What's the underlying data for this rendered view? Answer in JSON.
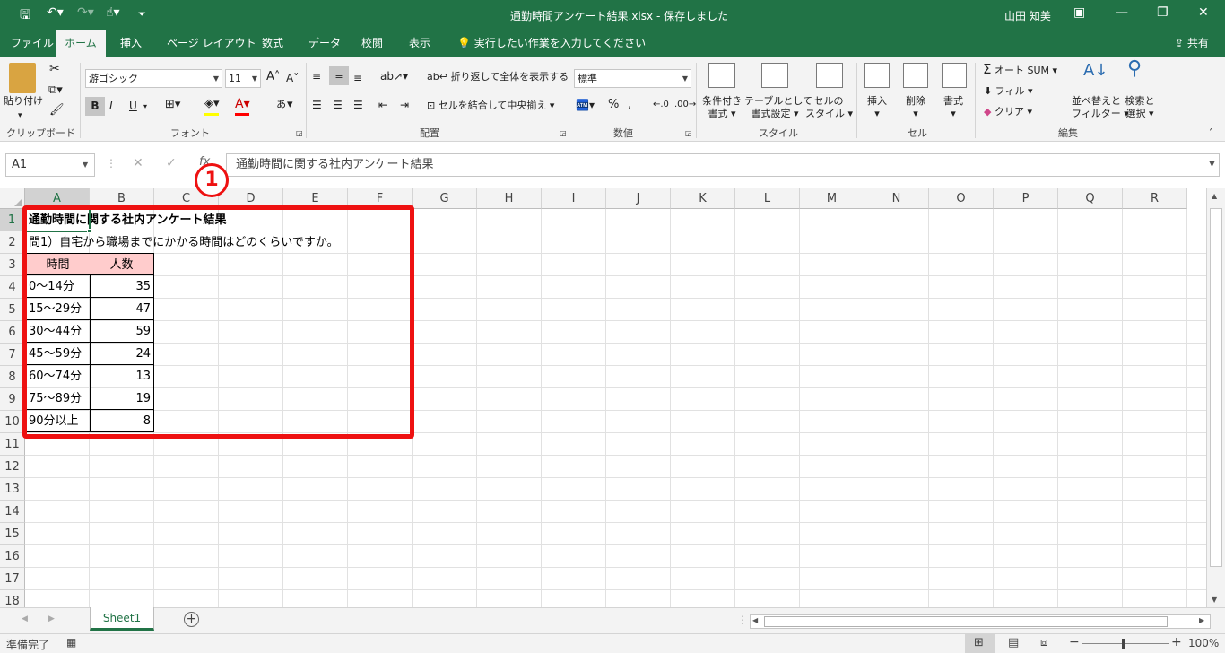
{
  "window": {
    "title": "通勤時間アンケート結果.xlsx  -  保存しました",
    "user": "山田 知美"
  },
  "ribbon_tabs": [
    "ファイル",
    "ホーム",
    "挿入",
    "ページ レイアウト",
    "数式",
    "データ",
    "校閲",
    "表示"
  ],
  "active_tab": "ホーム",
  "tell_me": "実行したい作業を入力してください",
  "share": "共有",
  "clipboard": {
    "paste": "貼り付け",
    "label": "クリップボード"
  },
  "font": {
    "name": "游ゴシック",
    "size": "11",
    "bold": "B",
    "italic": "I",
    "underline": "U",
    "label": "フォント"
  },
  "alignment": {
    "wrap": "折り返して全体を表示する",
    "merge": "セルを結合して中央揃え",
    "label": "配置"
  },
  "number": {
    "format": "標準",
    "label": "数値"
  },
  "styles": {
    "conditional": "条件付き",
    "conditional2": "書式",
    "table": "テーブルとして",
    "table2": "書式設定",
    "cell": "セルの",
    "cell2": "スタイル",
    "label": "スタイル"
  },
  "cells": {
    "insert": "挿入",
    "delete": "削除",
    "format": "書式",
    "label": "セル"
  },
  "editing": {
    "autosum": "オート SUM",
    "fill": "フィル",
    "clear": "クリア",
    "sort": "並べ替えと",
    "sort2": "フィルター",
    "find": "検索と",
    "find2": "選択",
    "label": "編集"
  },
  "namebox": "A1",
  "formula": "通勤時間に関する社内アンケート結果",
  "callout": "1",
  "columns": [
    "A",
    "B",
    "C",
    "D",
    "E",
    "F",
    "G",
    "H",
    "I",
    "J",
    "K",
    "L",
    "M",
    "N",
    "O",
    "P",
    "Q",
    "R"
  ],
  "rows": [
    "1",
    "2",
    "3",
    "4",
    "5",
    "6",
    "7",
    "8",
    "9",
    "10",
    "11",
    "12",
    "13",
    "14",
    "15",
    "16",
    "17",
    "18"
  ],
  "sheet": {
    "title": "通勤時間に関する社内アンケート結果",
    "question": "問1）自宅から職場までにかかる時間はどのくらいですか。",
    "headers": [
      "時間",
      "人数"
    ],
    "table": [
      {
        "range": "0〜14分",
        "count": "35"
      },
      {
        "range": "15〜29分",
        "count": "47"
      },
      {
        "range": "30〜44分",
        "count": "59"
      },
      {
        "range": "45〜59分",
        "count": "24"
      },
      {
        "range": "60〜74分",
        "count": "13"
      },
      {
        "range": "75〜89分",
        "count": "19"
      },
      {
        "range": "90分以上",
        "count": "8"
      }
    ]
  },
  "sheet_tab": "Sheet1",
  "status": {
    "ready": "準備完了",
    "zoom": "100%"
  },
  "colors": {
    "excel_green": "#217346",
    "header_fill": "#ffcccc",
    "callout_red": "#ee1111"
  }
}
